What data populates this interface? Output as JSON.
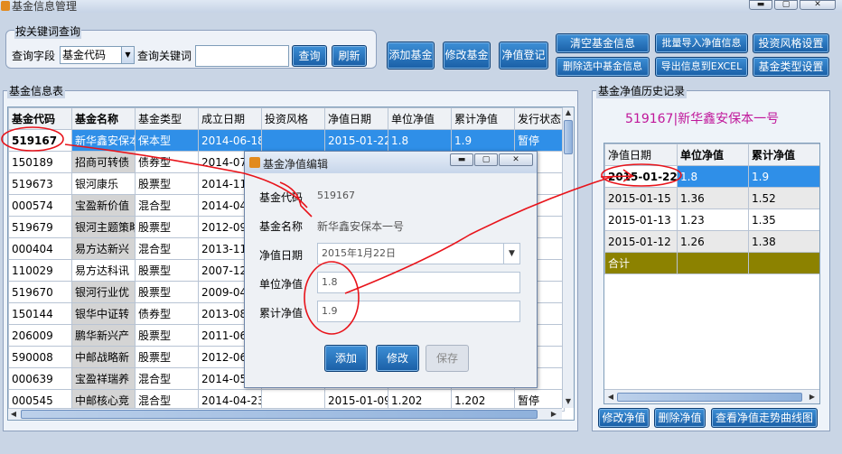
{
  "window": {
    "title": "基金信息管理",
    "min_label": "▬",
    "max_label": "▢",
    "close_label": "✕"
  },
  "search": {
    "group_label": "按关键词查询",
    "field_label": "查询字段",
    "field_value": "基金代码",
    "keyword_label": "查询关键词",
    "keyword_value": "",
    "query_button": "查询",
    "refresh_button": "刷新"
  },
  "toolbar": {
    "add_fund": "添加基金",
    "edit_fund": "修改基金",
    "nav_register": "净值登记",
    "clear_info": "清空基金信息",
    "delete_selected": "删除选中基金信息",
    "batch_import": "批量导入净值信息",
    "export_excel": "导出信息到EXCEL",
    "style_settings": "投资风格设置",
    "type_settings": "基金类型设置"
  },
  "fund_table": {
    "label": "基金信息表",
    "columns": [
      "基金代码",
      "基金名称",
      "基金类型",
      "成立日期",
      "投资风格",
      "净值日期",
      "单位净值",
      "累计净值",
      "发行状态"
    ],
    "rows": [
      [
        "519167",
        "新华鑫安保本",
        "保本型",
        "2014-06-18",
        "",
        "2015-01-22",
        "1.8",
        "1.9",
        "暂停"
      ],
      [
        "150189",
        "招商可转债",
        "债券型",
        "2014-07",
        "",
        "",
        "",
        "",
        ""
      ],
      [
        "519673",
        "银河康乐",
        "股票型",
        "2014-11",
        "",
        "",
        "",
        "",
        ""
      ],
      [
        "000574",
        "宝盈新价值",
        "混合型",
        "2014-04",
        "",
        "",
        "",
        "",
        ""
      ],
      [
        "519679",
        "银河主题策略",
        "股票型",
        "2012-09",
        "",
        "",
        "",
        "",
        ""
      ],
      [
        "000404",
        "易方达新兴",
        "混合型",
        "2013-11",
        "",
        "",
        "",
        "",
        ""
      ],
      [
        "110029",
        "易方达科讯",
        "股票型",
        "2007-12",
        "",
        "",
        "",
        "",
        ""
      ],
      [
        "519670",
        "银河行业优",
        "股票型",
        "2009-04",
        "",
        "",
        "",
        "",
        ""
      ],
      [
        "150144",
        "银华中证转",
        "债券型",
        "2013-08",
        "",
        "",
        "",
        "",
        ""
      ],
      [
        "206009",
        "鹏华新兴产",
        "股票型",
        "2011-06",
        "",
        "",
        "",
        "",
        ""
      ],
      [
        "590008",
        "中邮战略新",
        "股票型",
        "2012-06",
        "",
        "",
        "",
        "",
        ""
      ],
      [
        "000639",
        "宝盈祥瑞养",
        "混合型",
        "2014-05",
        "",
        "",
        "",
        "",
        ""
      ],
      [
        "000545",
        "中邮核心竞",
        "混合型",
        "2014-04-23",
        "",
        "2015-01-09",
        "1.202",
        "1.202",
        "暂停"
      ]
    ]
  },
  "history": {
    "label": "基金净值历史记录",
    "heading": "519167|新华鑫安保本一号",
    "columns": [
      "净值日期",
      "单位净值",
      "累计净值"
    ],
    "rows": [
      [
        "2015-01-22",
        "1.8",
        "1.9"
      ],
      [
        "2015-01-15",
        "1.36",
        "1.52"
      ],
      [
        "2015-01-13",
        "1.23",
        "1.35"
      ],
      [
        "2015-01-12",
        "1.26",
        "1.38"
      ]
    ],
    "total_label": "合计",
    "edit_button": "修改净值",
    "delete_button": "删除净值",
    "chart_button": "查看净值走势曲线图"
  },
  "dialog": {
    "title": "基金净值编辑",
    "code_label": "基金代码",
    "code_value": "519167",
    "name_label": "基金名称",
    "name_value": "新华鑫安保本一号",
    "date_label": "净值日期",
    "date_value": "2015年1月22日",
    "unit_label": "单位净值",
    "unit_value": "1.8",
    "cum_label": "累计净值",
    "cum_value": "1.9",
    "add_button": "添加",
    "edit_button": "修改",
    "save_button": "保存"
  },
  "colors": {
    "accent": "#2f8fe8",
    "annotation": "#e8141b",
    "history_heading": "#c0179a",
    "total_row": "#8c8200"
  }
}
